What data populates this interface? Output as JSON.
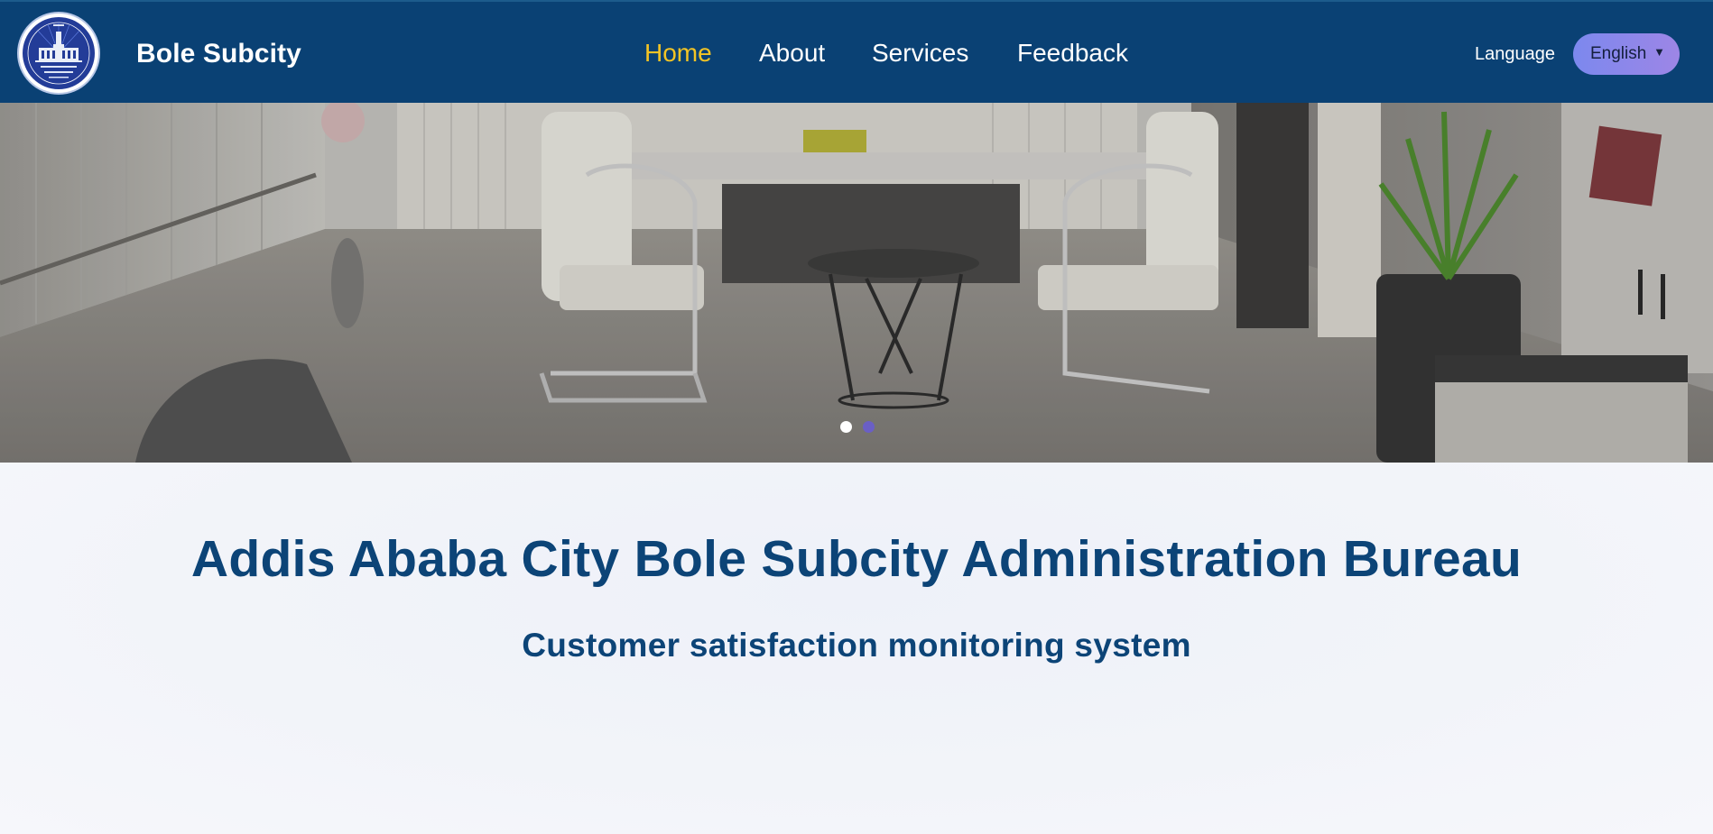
{
  "header": {
    "brand": "Bole Subcity",
    "logo_icon": "city-administration-seal-icon",
    "nav": [
      {
        "label": "Home",
        "active": true
      },
      {
        "label": "About",
        "active": false
      },
      {
        "label": "Services",
        "active": false
      },
      {
        "label": "Feedback",
        "active": false
      }
    ],
    "language_label": "Language",
    "language_selected": "English",
    "caret_icon": "caret-down-icon",
    "colors": {
      "navbar": "#0a4174",
      "active_link": "#f3c425",
      "select_gradient_start": "#7c88ee",
      "select_gradient_end": "#9d86e6"
    }
  },
  "carousel": {
    "image_subject": "office-interior-photo",
    "slide_count": 2,
    "active_slide": 1,
    "colors": {
      "active_dot": "#ffffff",
      "inactive_dot": "#6a5fc5"
    }
  },
  "main": {
    "title": "Addis Ababa City Bole Subcity Administration Bureau",
    "subtitle": "Customer satisfaction monitoring system",
    "colors": {
      "heading": "#0c4477"
    }
  }
}
